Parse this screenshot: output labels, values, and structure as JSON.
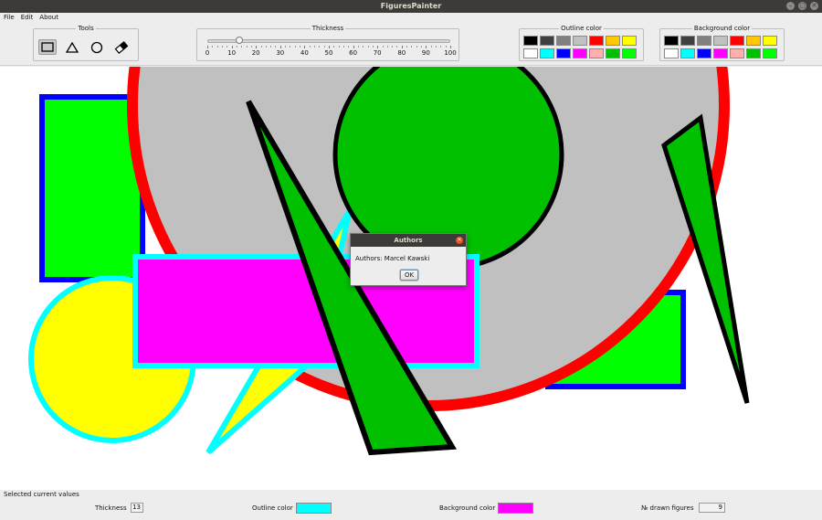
{
  "window": {
    "title": "FiguresPainter",
    "buttons": [
      "–",
      "▢",
      "✕"
    ]
  },
  "menu": {
    "items": [
      "File",
      "Edit",
      "About"
    ]
  },
  "tools": {
    "title": "Tools",
    "items": [
      {
        "name": "rectangle-tool",
        "icon": "rectangle-icon",
        "selected": true
      },
      {
        "name": "triangle-tool",
        "icon": "triangle-icon",
        "selected": false
      },
      {
        "name": "circle-tool",
        "icon": "circle-icon",
        "selected": false
      },
      {
        "name": "eraser-tool",
        "icon": "eraser-icon",
        "selected": false
      }
    ]
  },
  "thickness": {
    "title": "Thickness",
    "value": 13,
    "min": 0,
    "max": 100,
    "labels": [
      "0",
      "10",
      "20",
      "30",
      "40",
      "50",
      "60",
      "70",
      "80",
      "90",
      "100"
    ]
  },
  "outline_color": {
    "title": "Outline color",
    "colors": [
      "#000000",
      "#404040",
      "#808080",
      "#c0c0c0",
      "#ff0000",
      "#ffc800",
      "#ffff00",
      "#ffffff",
      "#00ffff",
      "#0000ff",
      "#ff00ff",
      "#ffafaf",
      "#00c000",
      "#00ff00"
    ]
  },
  "background_color": {
    "title": "Background color",
    "colors": [
      "#000000",
      "#404040",
      "#808080",
      "#c0c0c0",
      "#ff0000",
      "#ffc800",
      "#ffff00",
      "#ffffff",
      "#00ffff",
      "#0000ff",
      "#ff00ff",
      "#ffafaf",
      "#00c000",
      "#00ff00"
    ]
  },
  "canvas": {
    "figures": [
      {
        "type": "rectangle",
        "fill": "#00ff00",
        "stroke": "#0000ff"
      },
      {
        "type": "rectangle",
        "fill": "#00ff00",
        "stroke": "#0000ff"
      },
      {
        "type": "circle",
        "fill": "#c0c0c0",
        "stroke": "#ff0000"
      },
      {
        "type": "triangle",
        "fill": "#ffff00",
        "stroke": "#00ffff"
      },
      {
        "type": "circle",
        "fill": "#ffff00",
        "stroke": "#00ffff"
      },
      {
        "type": "circle",
        "fill": "#00c000",
        "stroke": "#000000"
      },
      {
        "type": "rectangle",
        "fill": "#ff00ff",
        "stroke": "#00ffff"
      },
      {
        "type": "triangle",
        "fill": "#00c000",
        "stroke": "#000000"
      },
      {
        "type": "triangle",
        "fill": "#00c000",
        "stroke": "#000000"
      }
    ]
  },
  "dialog": {
    "title": "Authors",
    "message": "Authors: Marcel Kawski",
    "ok_label": "OK"
  },
  "status": {
    "title": "Selected current values",
    "thickness_label": "Thickness",
    "thickness_value": "13",
    "outline_label": "Outline color",
    "outline_color": "#00ffff",
    "background_label": "Background color",
    "background_color": "#ff00ff",
    "drawn_label": "№ drawn figures",
    "drawn_value": "9"
  }
}
